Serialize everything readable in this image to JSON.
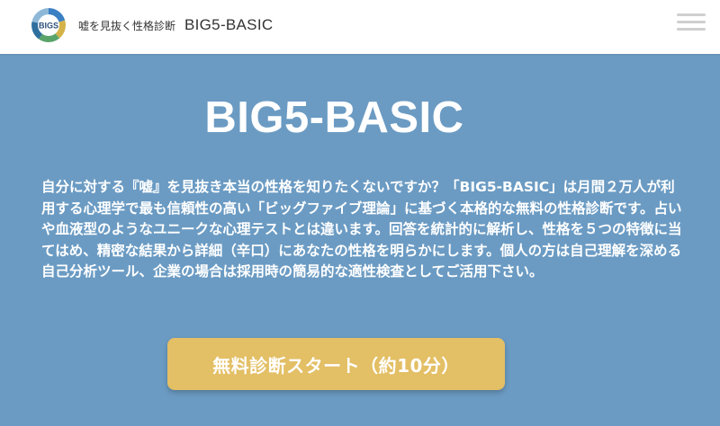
{
  "header": {
    "logo_text": "BIGS",
    "tagline": "嘘を見抜く性格診断",
    "brand": "BIG5-BASIC",
    "menu_icon": "hamburger-menu-icon"
  },
  "hero": {
    "title": "BIG5-BASIC",
    "description": "自分に対する『嘘』を見抜き本当の性格を知りたくないですか？「BIG5-BASIC」は月間２万人が利用する心理学で最も信頼性の高い「ビッグファイブ理論」に基づく本格的な無料の性格診断です。占いや血液型のようなユニークな心理テストとは違います。回答を統計的に解析し、性格を５つの特徴に当てはめ、精密な結果から詳細（辛口）にあなたの性格を明らかにします。個人の方は自己理解を深める自己分析ツール、企業の場合は採用時の簡易的な適性検査としてご活用下さい。",
    "cta_label": "無料診断スタート（約10分）"
  },
  "colors": {
    "background": "#6b9bc3",
    "header_background": "#ffffff",
    "cta_background": "#e3bf65",
    "text": "#ffffff"
  }
}
